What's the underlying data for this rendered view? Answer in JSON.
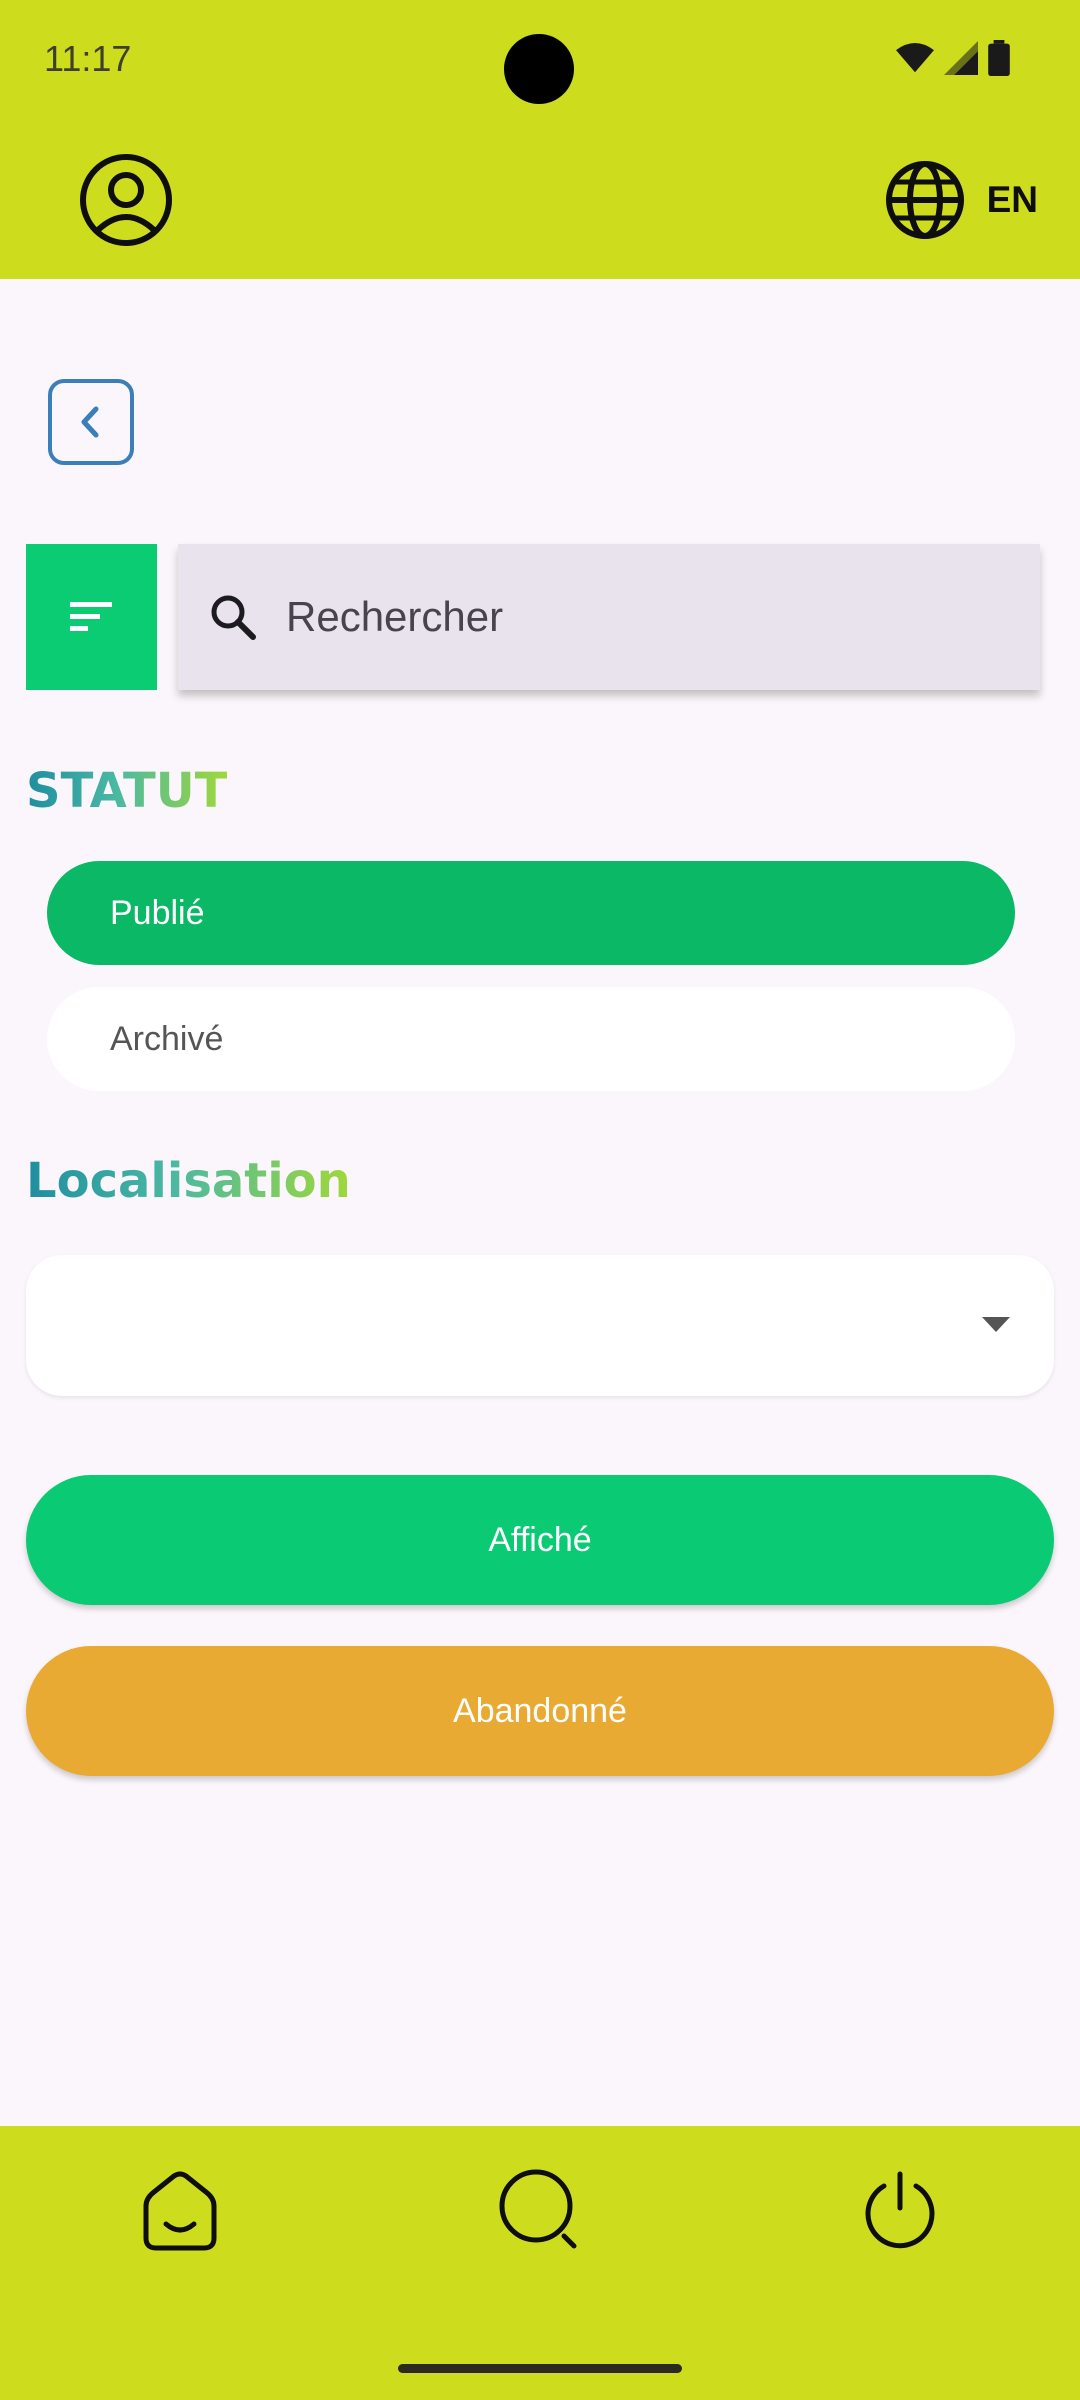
{
  "status_bar": {
    "time": "11:17"
  },
  "header": {
    "language_code": "EN"
  },
  "search": {
    "placeholder": "Rechercher"
  },
  "status_section": {
    "title": "STATUT",
    "options": [
      {
        "label": "Publié",
        "selected": true
      },
      {
        "label": "Archivé",
        "selected": false
      }
    ]
  },
  "location_section": {
    "title": "Localisation",
    "selected_value": ""
  },
  "actions": {
    "primary_label": "Affiché",
    "secondary_label": "Abandonné"
  },
  "colors": {
    "bar_background": "#cedc1e",
    "accent_green": "#0bcb73",
    "accent_orange": "#e9aa34",
    "back_outline": "#3a7fb9"
  },
  "icons": {
    "header_left": "account-circle-icon",
    "header_right": "globe-icon",
    "nav": [
      "home-icon",
      "search-icon",
      "power-icon"
    ]
  }
}
